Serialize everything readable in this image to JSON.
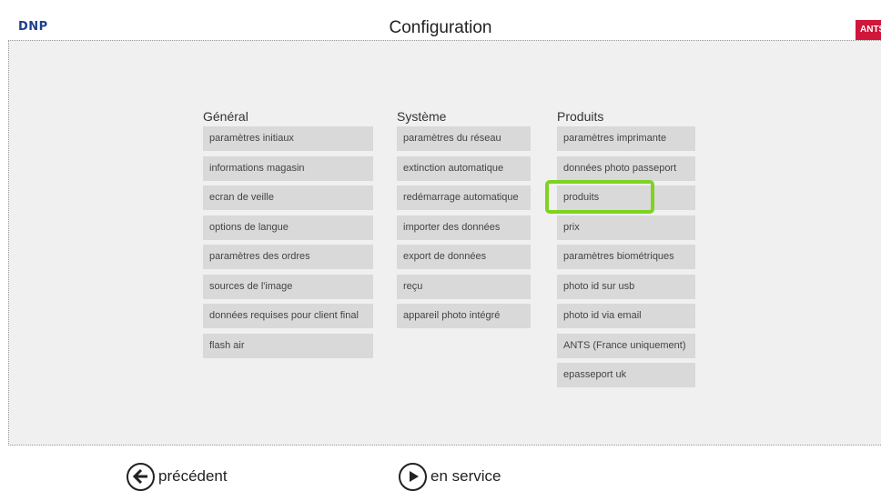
{
  "header": {
    "logo": "DNP",
    "title": "Configuration",
    "badge": "ANTS"
  },
  "columns": {
    "general": {
      "heading": "Général",
      "items": [
        "paramètres initiaux",
        "informations magasin",
        "ecran de veille",
        "options de langue",
        "paramètres des ordres",
        "sources de l'image",
        "données requises pour client final",
        "flash air"
      ]
    },
    "systeme": {
      "heading": "Système",
      "items": [
        "paramètres du réseau",
        "extinction automatique",
        "redémarrage automatique",
        "importer des données",
        "export de données",
        "reçu",
        "appareil photo intégré"
      ]
    },
    "produits": {
      "heading": "Produits",
      "items": [
        "paramètres imprimante",
        "données photo passeport",
        "produits",
        "prix",
        "paramètres biométriques",
        "photo id sur usb",
        "photo id via email",
        "ANTS (France uniquement)",
        "epasseport uk"
      ]
    }
  },
  "footer": {
    "prev_label": "précédent",
    "service_label": "en service"
  },
  "colors": {
    "highlight": "#7ed321",
    "badge": "#d0163a",
    "logo": "#1f3f8f"
  }
}
